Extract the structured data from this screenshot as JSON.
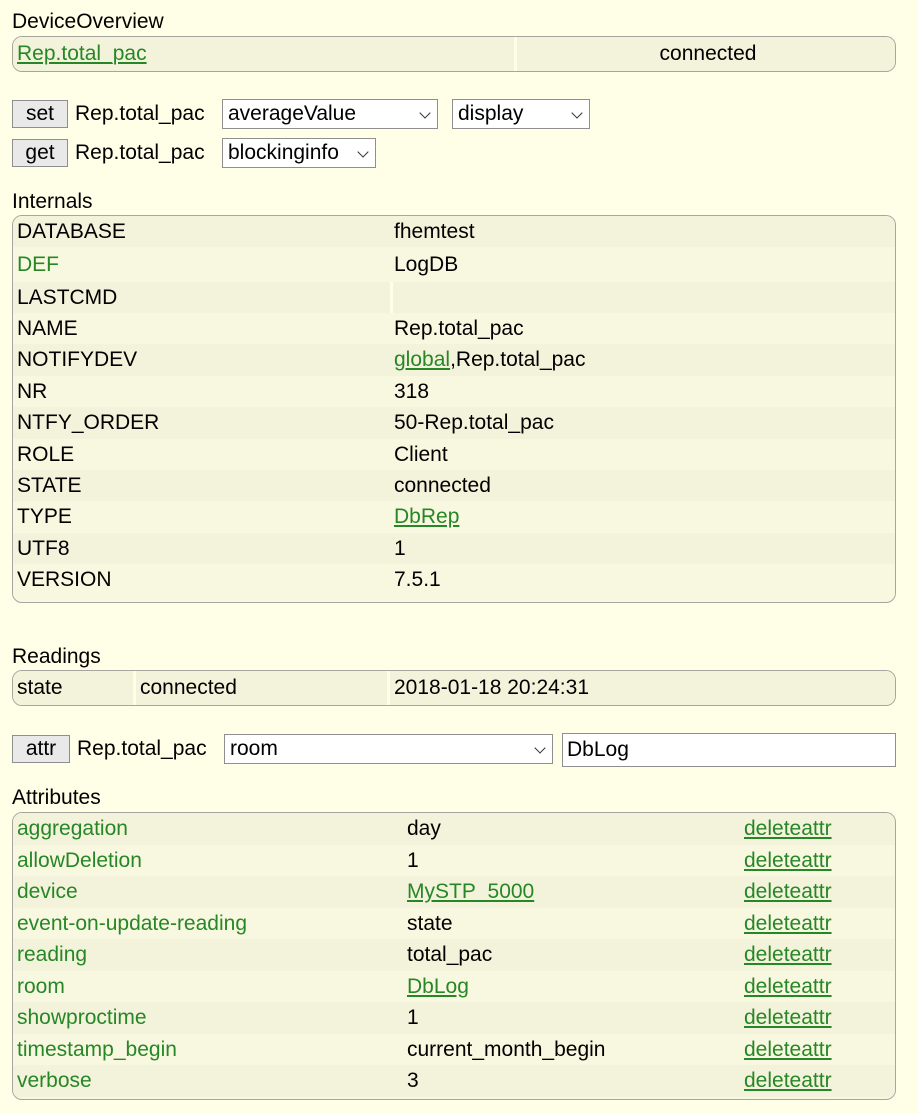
{
  "overview": {
    "title": "DeviceOverview",
    "device_name": "Rep.total_pac",
    "state": "connected"
  },
  "set_command": {
    "button": "set",
    "device": "Rep.total_pac",
    "selected": "averageValue",
    "option2": "display"
  },
  "get_command": {
    "button": "get",
    "device": "Rep.total_pac",
    "selected": "blockinginfo"
  },
  "internals": {
    "title": "Internals",
    "rows": [
      {
        "key": "DATABASE",
        "value": "fhemtest"
      },
      {
        "key": "DEF",
        "value": "LogDB"
      },
      {
        "key": "LASTCMD",
        "value": ""
      },
      {
        "key": "NAME",
        "value": "Rep.total_pac"
      },
      {
        "key": "NOTIFYDEV",
        "value_link": "global",
        "value_rest": ",Rep.total_pac"
      },
      {
        "key": "NR",
        "value": "318"
      },
      {
        "key": "NTFY_ORDER",
        "value": "50-Rep.total_pac"
      },
      {
        "key": "ROLE",
        "value": "Client"
      },
      {
        "key": "STATE",
        "value": "connected"
      },
      {
        "key": "TYPE",
        "value": "DbRep"
      },
      {
        "key": "UTF8",
        "value": "1"
      },
      {
        "key": "VERSION",
        "value": "7.5.1"
      }
    ]
  },
  "readings": {
    "title": "Readings",
    "rows": [
      {
        "name": "state",
        "value": "connected",
        "timestamp": "2018-01-18 20:24:31"
      }
    ]
  },
  "attr_command": {
    "button": "attr",
    "device": "Rep.total_pac",
    "selected": "room",
    "value": "DbLog"
  },
  "attributes": {
    "title": "Attributes",
    "delete_label": "deleteattr",
    "rows": [
      {
        "name": "aggregation",
        "value": "day"
      },
      {
        "name": "allowDeletion",
        "value": "1"
      },
      {
        "name": "device",
        "value": "MySTP_5000"
      },
      {
        "name": "event-on-update-reading",
        "value": "state"
      },
      {
        "name": "reading",
        "value": "total_pac"
      },
      {
        "name": "room",
        "value": "DbLog"
      },
      {
        "name": "showproctime",
        "value": "1"
      },
      {
        "name": "timestamp_begin",
        "value": "current_month_begin"
      },
      {
        "name": "verbose",
        "value": "3"
      }
    ]
  },
  "colors": {
    "background": "#FFFFE7",
    "link": "#278727",
    "row_odd": "#F3F3DB",
    "row_even": "#F8F8E0",
    "border": "#A6A6A0"
  }
}
